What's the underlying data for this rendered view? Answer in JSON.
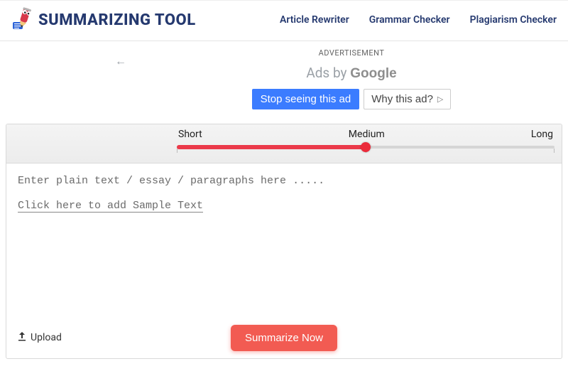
{
  "header": {
    "brand": "SUMMARIZING TOOL",
    "nav": [
      "Article Rewriter",
      "Grammar Checker",
      "Plagiarism Checker"
    ]
  },
  "ad": {
    "label": "ADVERTISEMENT",
    "ads_by_prefix": "Ads by ",
    "ads_by_brand": "Google",
    "stop": "Stop seeing this ad",
    "why": "Why this ad?"
  },
  "slider": {
    "short": "Short",
    "medium": "Medium",
    "long": "Long",
    "value_percent": 50
  },
  "editor": {
    "placeholder": "Enter plain text / essay / paragraphs here .....",
    "sample_link": "Click here to add Sample Text"
  },
  "actions": {
    "upload": "Upload",
    "summarize": "Summarize Now"
  },
  "colors": {
    "brand_blue": "#25396f",
    "accent_red": "#f25b52",
    "slider_red": "#eb3a4a",
    "ad_blue": "#3b7cff"
  }
}
